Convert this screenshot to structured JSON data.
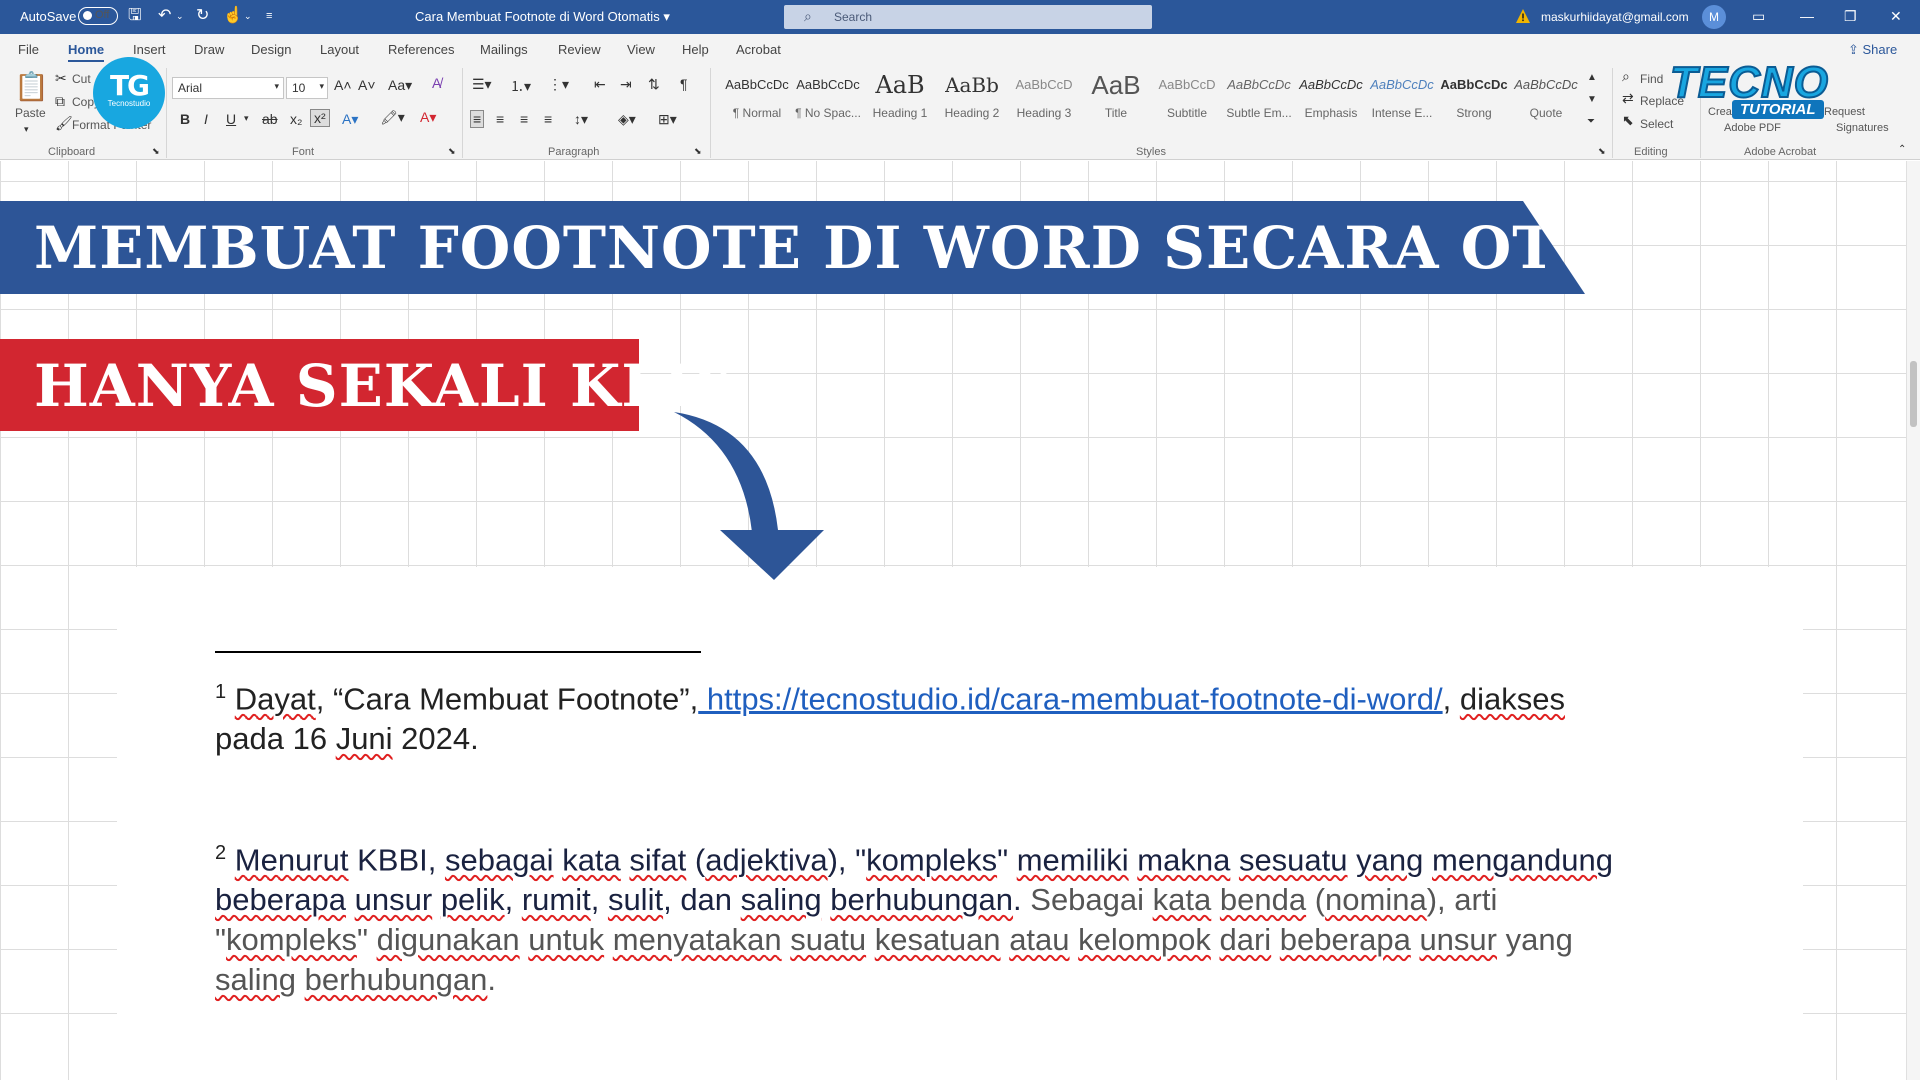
{
  "titlebar": {
    "autosave_label": "AutoSave",
    "autosave_state": "Off",
    "doc_title": "Cara Membuat Footnote di Word Otomatis",
    "doc_title_chevron": "▾",
    "search_placeholder": "Search",
    "account_email": "maskurhiidayat@gmail.com",
    "avatar_initial": "M"
  },
  "menu": {
    "items": [
      "File",
      "Home",
      "Insert",
      "Draw",
      "Design",
      "Layout",
      "References",
      "Mailings",
      "Review",
      "View",
      "Help",
      "Acrobat"
    ],
    "active": "Home",
    "share_label": "Share"
  },
  "ribbon": {
    "clipboard": {
      "paste": "Paste",
      "cut": "Cut",
      "copy": "Copy",
      "format_painter": "Format Painter",
      "group_label": "Clipboard"
    },
    "font": {
      "name": "Arial",
      "size": "10",
      "group_label": "Font"
    },
    "paragraph": {
      "group_label": "Paragraph"
    },
    "styles": {
      "group_label": "Styles",
      "items": [
        {
          "preview": "AaBbCcDc",
          "name": "¶ Normal"
        },
        {
          "preview": "AaBbCcDc",
          "name": "¶ No Spac..."
        },
        {
          "preview": "AaB",
          "name": "Heading 1"
        },
        {
          "preview": "AaBb",
          "name": "Heading 2"
        },
        {
          "preview": "AaBbCcD",
          "name": "Heading 3"
        },
        {
          "preview": "AaB",
          "name": "Title"
        },
        {
          "preview": "AaBbCcD",
          "name": "Subtitle"
        },
        {
          "preview": "AaBbCcDc",
          "name": "Subtle Em..."
        },
        {
          "preview": "AaBbCcDc",
          "name": "Emphasis"
        },
        {
          "preview": "AaBbCcDc",
          "name": "Intense E..."
        },
        {
          "preview": "AaBbCcDc",
          "name": "Strong"
        },
        {
          "preview": "AaBbCcDc",
          "name": "Quote"
        }
      ]
    },
    "editing": {
      "find": "Find",
      "replace": "Replace",
      "select": "Select",
      "group_label": "Editing"
    },
    "acrobat": {
      "create": "Create",
      "share_pdf": "Adobe PDF",
      "request": "Request",
      "signatures": "Signatures",
      "group_label": "Adobe Acrobat"
    }
  },
  "overlay": {
    "banner_title": "MEMBUAT FOOTNOTE DI WORD SECARA OTOMATIS",
    "banner_subtitle": "HANYA SEKALI KLIK",
    "logo_left_mark": "TG",
    "logo_left_name": "Tecnostudio",
    "logo_right_big": "TECNO",
    "logo_right_small": "TUTORIAL"
  },
  "document": {
    "footnotes": [
      {
        "number": "1",
        "author": "Dayat",
        "title": ", “Cara Membuat Footnote”,",
        "url": " https://tecnostudio.id/cara-membuat-footnote-di-word/",
        "sep": ",",
        "accessed_word": "diakses",
        "line2_pre": "pada 16",
        "month": "Juni",
        "year": " 2024."
      },
      {
        "number": "2",
        "w": [
          "Menurut",
          " KBBI, ",
          "sebagai",
          " ",
          "kata",
          " ",
          "sifat",
          " (",
          "adjektiva",
          "), \"",
          "kompleks",
          "\" ",
          "memiliki",
          " ",
          "makna",
          " ",
          "sesuatu",
          " ",
          "yang",
          " ",
          "mengandung",
          "beberapa",
          " ",
          "unsur",
          " ",
          "pelik",
          ", ",
          "rumit",
          ", ",
          "sulit",
          ", ",
          "dan",
          " ",
          "saling",
          " ",
          "berhubungan",
          ".",
          " Sebagai ",
          "kata",
          " ",
          "benda",
          " (",
          "nomina",
          "), arti",
          "\"",
          "kompleks",
          "\" ",
          "digunakan",
          " ",
          "untuk",
          " ",
          "menyatakan",
          " ",
          "suatu",
          " ",
          "kesatuan",
          " ",
          "atau",
          " ",
          "kelompok",
          " ",
          "dari",
          " ",
          "beberapa",
          " ",
          "unsur",
          " yang",
          "saling",
          " ",
          "berhubungan",
          "."
        ]
      }
    ]
  }
}
